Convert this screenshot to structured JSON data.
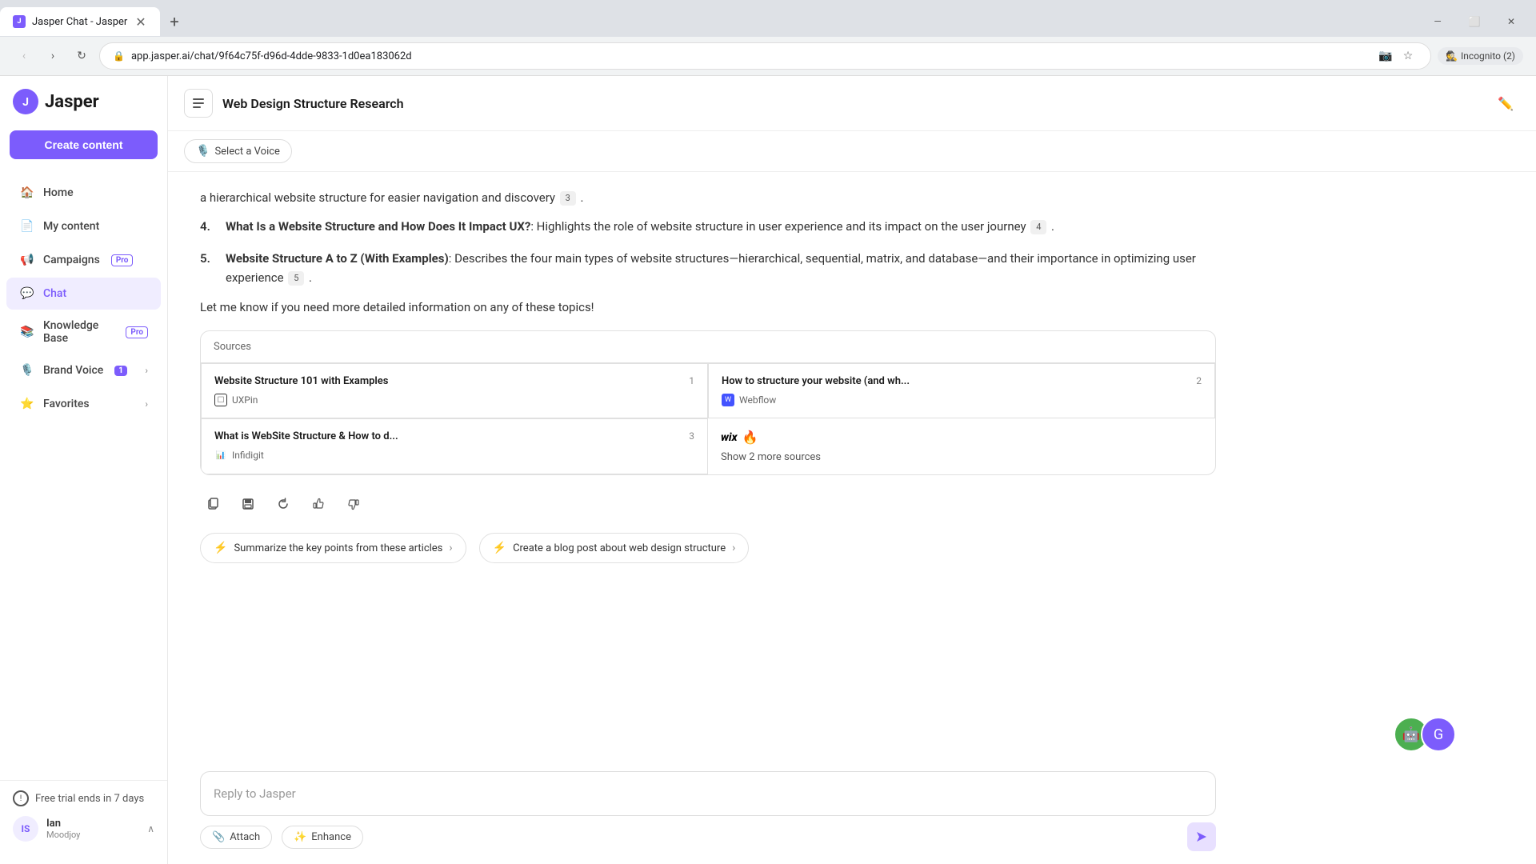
{
  "browser": {
    "tab_title": "Jasper Chat - Jasper",
    "tab_favicon": "J",
    "url": "app.jasper.ai/chat/9f64c75f-d96d-4dde-9833-1d0ea183062d",
    "incognito": "Incognito (2)"
  },
  "sidebar": {
    "logo_text": "Jasper",
    "create_button": "Create content",
    "nav_items": [
      {
        "id": "home",
        "label": "Home",
        "icon": "🏠",
        "badge": null
      },
      {
        "id": "my-content",
        "label": "My content",
        "icon": "📄",
        "badge": null
      },
      {
        "id": "campaigns",
        "label": "Campaigns",
        "icon": "📢",
        "badge": "Pro",
        "badge_type": "outline"
      },
      {
        "id": "chat",
        "label": "Chat",
        "icon": "💬",
        "badge": null,
        "active": true
      },
      {
        "id": "knowledge-base",
        "label": "Knowledge Base",
        "icon": "📚",
        "badge": "Pro",
        "badge_type": "outline"
      },
      {
        "id": "brand-voice",
        "label": "Brand Voice",
        "icon": "🎙️",
        "badge": "1",
        "badge_type": "filled",
        "expandable": true
      },
      {
        "id": "favorites",
        "label": "Favorites",
        "icon": "⭐",
        "badge": null,
        "expandable": true
      }
    ],
    "trial_text": "Free trial ends in 7 days",
    "user": {
      "initials": "IS",
      "name": "Ian",
      "company": "Moodjoy"
    }
  },
  "header": {
    "title": "Web Design Structure Research",
    "edit_icon": "✏️"
  },
  "voice_bar": {
    "select_label": "Select a Voice"
  },
  "chat": {
    "partial_text": "a hierarchical website structure for easier navigation and discovery",
    "partial_cite": "3",
    "items": [
      {
        "num": "4",
        "title": "What Is a Website Structure and How Does It Impact UX?",
        "description": "Highlights the role of website structure in user experience and its impact on the user journey",
        "cite": "4"
      },
      {
        "num": "5",
        "title": "Website Structure A to Z (With Examples)",
        "description": "Describes the four main types of website structures—hierarchical, sequential, matrix, and database—and their importance in optimizing user experience",
        "cite": "5"
      }
    ],
    "closing": "Let me know if you need more detailed information on any of these topics!",
    "sources_label": "Sources",
    "sources": [
      {
        "title": "Website Structure 101 with Examples",
        "num": "1",
        "domain": "UXPin",
        "favicon_type": "uxpin"
      },
      {
        "title": "How to structure your website (and wh...",
        "num": "2",
        "domain": "Webflow",
        "favicon_type": "webflow"
      },
      {
        "title": "What is WebSite Structure & How to d...",
        "num": "3",
        "domain": "Infidigit",
        "favicon_type": "infidigit"
      }
    ],
    "show_more": "Show 2 more sources",
    "action_icons": [
      "copy",
      "save",
      "refresh",
      "thumbs-up",
      "thumbs-down"
    ],
    "suggestions": [
      {
        "text": "Summarize the key points from these articles",
        "icon": "⚡"
      },
      {
        "text": "Create a blog post about web design structure",
        "icon": "⚡"
      }
    ],
    "reply_placeholder": "Reply to Jasper",
    "attach_label": "Attach",
    "enhance_label": "Enhance"
  }
}
